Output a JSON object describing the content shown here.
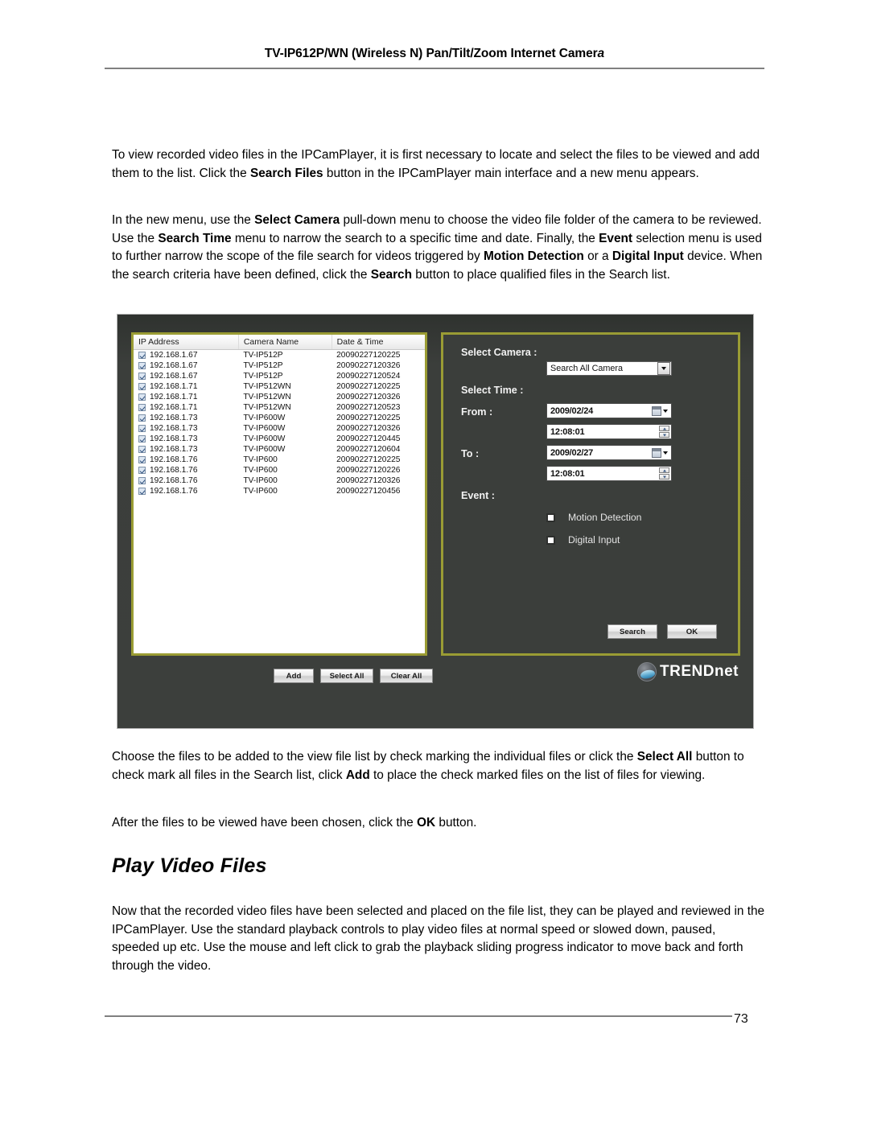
{
  "header": {
    "title_main": "TV-IP612P/WN (Wireless N) Pan/Tilt/Zoom Internet Camer",
    "title_tail": "a"
  },
  "paragraphs": {
    "p1_a": "To view recorded video files in the IPCamPlayer, it is first necessary to locate and select the files to be viewed and add them to the list. Click the ",
    "p1_b": "Search Files",
    "p1_c": " button in the IPCamPlayer main interface and a new menu appears.",
    "p2_a": "In the new menu, use the ",
    "p2_b": "Select Camera",
    "p2_c": " pull-down menu to choose the video file folder of the camera to be reviewed. Use the ",
    "p2_d": "Search Time",
    "p2_e": " menu to narrow the search to a specific time and date. Finally, the ",
    "p2_f": "Event",
    "p2_g": " selection menu is used to further narrow the scope of the file search for videos triggered by ",
    "p2_h": "Motion Detection",
    "p2_i": " or a ",
    "p2_j": "Digital Input",
    "p2_k": " device. When the search criteria have been defined, click the ",
    "p2_l": "Search",
    "p2_m": " button to place qualified files in the Search list.",
    "p3_a": "Choose the files to be added to the view file list by check marking the individual files or click the ",
    "p3_b": "Select All",
    "p3_c": " button to check mark all files in the Search list, click ",
    "p3_d": "Add",
    "p3_e": " to place the check marked files on the list of files for viewing.",
    "p4_a": "After the files to be viewed have been chosen, click the ",
    "p4_b": "OK",
    "p4_c": " button.",
    "p5": "Now that the recorded video files have been selected and placed on the file list, they can be played and reviewed in the IPCamPlayer.  Use the standard playback controls to play video files at normal speed or slowed down, paused, speeded up etc. Use the mouse and left click to grab the playback sliding progress indicator to move back and forth through the video."
  },
  "section_heading": "Play Video Files",
  "dialog": {
    "table": {
      "columns": [
        "IP Address",
        "Camera Name",
        "Date & Time"
      ],
      "rows": [
        {
          "checked": true,
          "ip": "192.168.1.67",
          "camera": "TV-IP512P",
          "datetime": "20090227120225"
        },
        {
          "checked": true,
          "ip": "192.168.1.67",
          "camera": "TV-IP512P",
          "datetime": "20090227120326"
        },
        {
          "checked": true,
          "ip": "192.168.1.67",
          "camera": "TV-IP512P",
          "datetime": "20090227120524"
        },
        {
          "checked": true,
          "ip": "192.168.1.71",
          "camera": "TV-IP512WN",
          "datetime": "20090227120225"
        },
        {
          "checked": true,
          "ip": "192.168.1.71",
          "camera": "TV-IP512WN",
          "datetime": "20090227120326"
        },
        {
          "checked": true,
          "ip": "192.168.1.71",
          "camera": "TV-IP512WN",
          "datetime": "20090227120523"
        },
        {
          "checked": true,
          "ip": "192.168.1.73",
          "camera": "TV-IP600W",
          "datetime": "20090227120225"
        },
        {
          "checked": true,
          "ip": "192.168.1.73",
          "camera": "TV-IP600W",
          "datetime": "20090227120326"
        },
        {
          "checked": true,
          "ip": "192.168.1.73",
          "camera": "TV-IP600W",
          "datetime": "20090227120445"
        },
        {
          "checked": true,
          "ip": "192.168.1.73",
          "camera": "TV-IP600W",
          "datetime": "20090227120604"
        },
        {
          "checked": true,
          "ip": "192.168.1.76",
          "camera": "TV-IP600",
          "datetime": "20090227120225"
        },
        {
          "checked": true,
          "ip": "192.168.1.76",
          "camera": "TV-IP600",
          "datetime": "20090227120226"
        },
        {
          "checked": true,
          "ip": "192.168.1.76",
          "camera": "TV-IP600",
          "datetime": "20090227120326"
        },
        {
          "checked": true,
          "ip": "192.168.1.76",
          "camera": "TV-IP600",
          "datetime": "20090227120456"
        }
      ]
    },
    "labels": {
      "select_camera": "Select Camera :",
      "select_time": "Select Time :",
      "from": "From :",
      "to": "To :",
      "event": "Event :"
    },
    "camera_select": {
      "value": "Search All Camera"
    },
    "from": {
      "date": "2009/02/24",
      "time": "12:08:01"
    },
    "to": {
      "date": "2009/02/27",
      "time": "12:08:01"
    },
    "events": [
      {
        "label": "Motion Detection",
        "checked": false
      },
      {
        "label": "Digital Input",
        "checked": false
      }
    ],
    "buttons": {
      "search": "Search",
      "ok": "OK",
      "add": "Add",
      "select_all": "Select All",
      "clear_all": "Clear All"
    },
    "logo_text": "TRENDnet",
    "colors": {
      "panel_bg": "#3b3e3b",
      "panel_border": "#9a9c34",
      "list_bg": "#ffffff"
    }
  },
  "footer": {
    "page_number": "73"
  }
}
